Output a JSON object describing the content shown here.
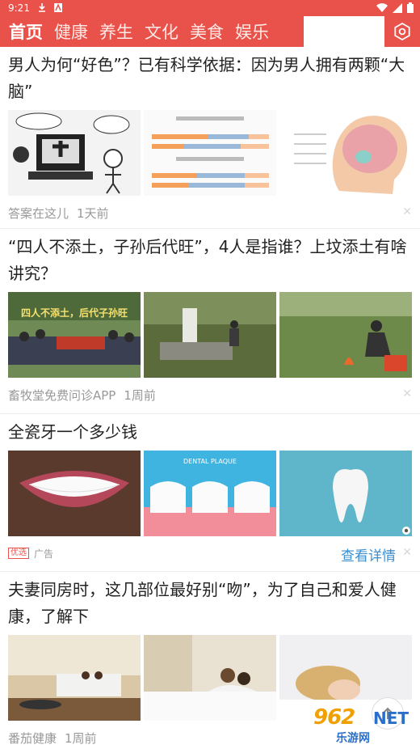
{
  "status": {
    "time": "9:21"
  },
  "tabs": [
    {
      "label": "首页"
    },
    {
      "label": "健康"
    },
    {
      "label": "养生"
    },
    {
      "label": "文化"
    },
    {
      "label": "美食"
    },
    {
      "label": "娱乐"
    }
  ],
  "articles": [
    {
      "title": "男人为何“好色”？已有科学依据：因为男人拥有两颗“大脑”",
      "source": "答案在这儿",
      "time": "1天前"
    },
    {
      "title": "“四人不添土，子孙后代旺”，4人是指谁？上坟添土有啥讲究？",
      "source": "畜牧堂免费问诊APP",
      "time": "1周前",
      "image_caption": "四人不添土，后代子孙旺"
    },
    {
      "title": "全瓷牙一个多少钱",
      "ad_badge": "优选",
      "ad_label": "广告",
      "ad_link": "查看详情",
      "image_caption": "DENTAL PLAQUE"
    },
    {
      "title": "夫妻同房时，这几部位最好别“吻”，为了自己和爱人健康，了解下",
      "source": "番茄健康",
      "time": "1周前"
    }
  ],
  "watermark": {
    "number": "962",
    "net": "NET",
    "sub": "乐游网"
  },
  "colors": {
    "brand": "#e8524a",
    "link": "#3b8fd1",
    "meta": "#999999"
  }
}
